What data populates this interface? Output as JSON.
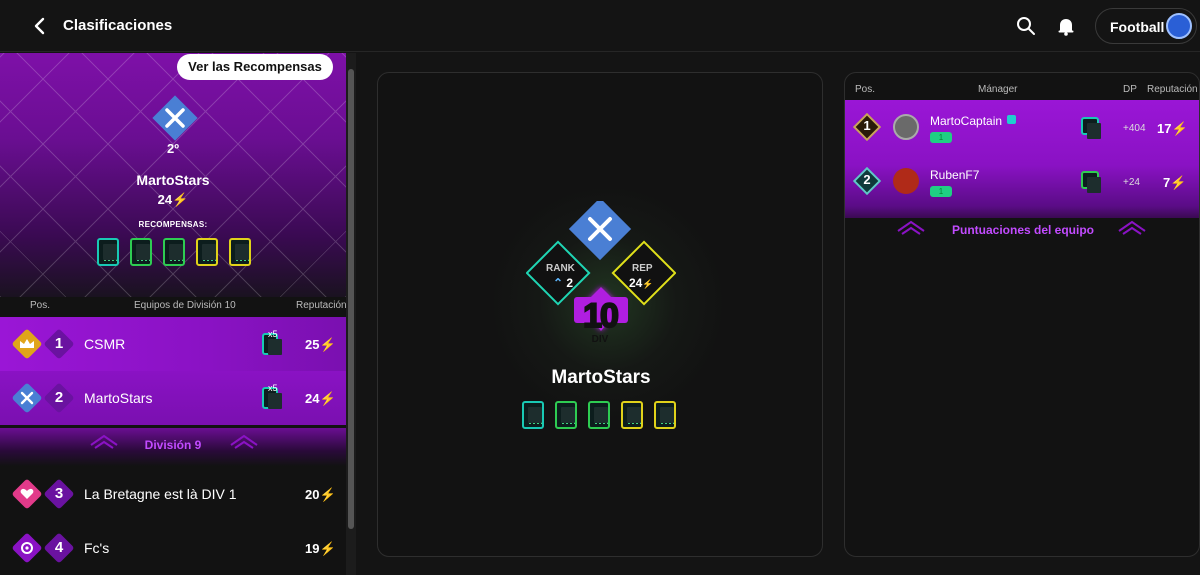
{
  "topbar": {
    "title": "Clasificaciones",
    "sport_label": "Football",
    "icons": [
      "back-arrow-icon",
      "search-icon",
      "bell-icon",
      "avatar"
    ]
  },
  "hero": {
    "rewards_button": "Ver las Recompensas",
    "rank": "2º",
    "name": "MartoStars",
    "rep": "24",
    "rewards_label": "RECOMPENSAS:",
    "reward_cards": [
      "teal",
      "green",
      "green",
      "yellow",
      "yellow"
    ]
  },
  "table": {
    "header": {
      "pos": "Pos.",
      "teams": "Equipos de División 10",
      "rep": "Reputación"
    },
    "rows_top": [
      {
        "pos": "1",
        "name": "CSMR",
        "multiplier": "x5",
        "rep": "25"
      },
      {
        "pos": "2",
        "name": "MartoStars",
        "multiplier": "x5",
        "rep": "24"
      }
    ],
    "division_sep": "División 9",
    "rows_bottom": [
      {
        "pos": "3",
        "name": "La Bretagne est là DIV 1",
        "rep": "20"
      },
      {
        "pos": "4",
        "name": "Fc's",
        "rep": "19"
      }
    ]
  },
  "center": {
    "rank_label": "RANK",
    "rank_value": "2",
    "rep_label": "REP",
    "rep_value": "24",
    "division_number": "10",
    "division_label": "DIV",
    "name": "MartoStars",
    "reward_cards": [
      "teal",
      "green",
      "green",
      "yellow",
      "yellow"
    ]
  },
  "managers": {
    "header": {
      "pos": "Pos.",
      "manager": "Mánager",
      "dp": "DP",
      "rep": "Reputación"
    },
    "rows": [
      {
        "pos": "1",
        "name": "MartoCaptain",
        "level": "1",
        "dp": "+404",
        "rep": "17"
      },
      {
        "pos": "2",
        "name": "RubenF7",
        "level": "1",
        "dp": "+24",
        "rep": "7"
      }
    ],
    "team_scores_label": "Puntuaciones del equipo"
  },
  "colors": {
    "accent_purple": "#9a16d6",
    "division_text": "#c24bff",
    "bolt": "#f5d020",
    "gold": "#e0a51a",
    "pink": "#e23a8a"
  }
}
